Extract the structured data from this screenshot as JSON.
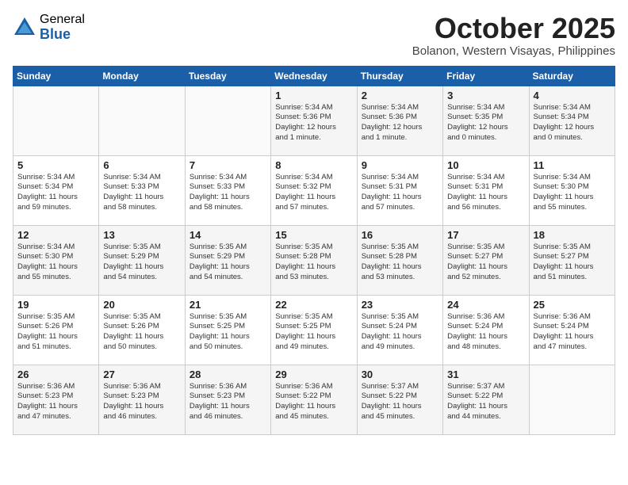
{
  "header": {
    "logo_general": "General",
    "logo_blue": "Blue",
    "month": "October 2025",
    "location": "Bolanon, Western Visayas, Philippines"
  },
  "days_of_week": [
    "Sunday",
    "Monday",
    "Tuesday",
    "Wednesday",
    "Thursday",
    "Friday",
    "Saturday"
  ],
  "weeks": [
    [
      {
        "day": "",
        "info": ""
      },
      {
        "day": "",
        "info": ""
      },
      {
        "day": "",
        "info": ""
      },
      {
        "day": "1",
        "info": "Sunrise: 5:34 AM\nSunset: 5:36 PM\nDaylight: 12 hours\nand 1 minute."
      },
      {
        "day": "2",
        "info": "Sunrise: 5:34 AM\nSunset: 5:36 PM\nDaylight: 12 hours\nand 1 minute."
      },
      {
        "day": "3",
        "info": "Sunrise: 5:34 AM\nSunset: 5:35 PM\nDaylight: 12 hours\nand 0 minutes."
      },
      {
        "day": "4",
        "info": "Sunrise: 5:34 AM\nSunset: 5:34 PM\nDaylight: 12 hours\nand 0 minutes."
      }
    ],
    [
      {
        "day": "5",
        "info": "Sunrise: 5:34 AM\nSunset: 5:34 PM\nDaylight: 11 hours\nand 59 minutes."
      },
      {
        "day": "6",
        "info": "Sunrise: 5:34 AM\nSunset: 5:33 PM\nDaylight: 11 hours\nand 58 minutes."
      },
      {
        "day": "7",
        "info": "Sunrise: 5:34 AM\nSunset: 5:33 PM\nDaylight: 11 hours\nand 58 minutes."
      },
      {
        "day": "8",
        "info": "Sunrise: 5:34 AM\nSunset: 5:32 PM\nDaylight: 11 hours\nand 57 minutes."
      },
      {
        "day": "9",
        "info": "Sunrise: 5:34 AM\nSunset: 5:31 PM\nDaylight: 11 hours\nand 57 minutes."
      },
      {
        "day": "10",
        "info": "Sunrise: 5:34 AM\nSunset: 5:31 PM\nDaylight: 11 hours\nand 56 minutes."
      },
      {
        "day": "11",
        "info": "Sunrise: 5:34 AM\nSunset: 5:30 PM\nDaylight: 11 hours\nand 55 minutes."
      }
    ],
    [
      {
        "day": "12",
        "info": "Sunrise: 5:34 AM\nSunset: 5:30 PM\nDaylight: 11 hours\nand 55 minutes."
      },
      {
        "day": "13",
        "info": "Sunrise: 5:35 AM\nSunset: 5:29 PM\nDaylight: 11 hours\nand 54 minutes."
      },
      {
        "day": "14",
        "info": "Sunrise: 5:35 AM\nSunset: 5:29 PM\nDaylight: 11 hours\nand 54 minutes."
      },
      {
        "day": "15",
        "info": "Sunrise: 5:35 AM\nSunset: 5:28 PM\nDaylight: 11 hours\nand 53 minutes."
      },
      {
        "day": "16",
        "info": "Sunrise: 5:35 AM\nSunset: 5:28 PM\nDaylight: 11 hours\nand 53 minutes."
      },
      {
        "day": "17",
        "info": "Sunrise: 5:35 AM\nSunset: 5:27 PM\nDaylight: 11 hours\nand 52 minutes."
      },
      {
        "day": "18",
        "info": "Sunrise: 5:35 AM\nSunset: 5:27 PM\nDaylight: 11 hours\nand 51 minutes."
      }
    ],
    [
      {
        "day": "19",
        "info": "Sunrise: 5:35 AM\nSunset: 5:26 PM\nDaylight: 11 hours\nand 51 minutes."
      },
      {
        "day": "20",
        "info": "Sunrise: 5:35 AM\nSunset: 5:26 PM\nDaylight: 11 hours\nand 50 minutes."
      },
      {
        "day": "21",
        "info": "Sunrise: 5:35 AM\nSunset: 5:25 PM\nDaylight: 11 hours\nand 50 minutes."
      },
      {
        "day": "22",
        "info": "Sunrise: 5:35 AM\nSunset: 5:25 PM\nDaylight: 11 hours\nand 49 minutes."
      },
      {
        "day": "23",
        "info": "Sunrise: 5:35 AM\nSunset: 5:24 PM\nDaylight: 11 hours\nand 49 minutes."
      },
      {
        "day": "24",
        "info": "Sunrise: 5:36 AM\nSunset: 5:24 PM\nDaylight: 11 hours\nand 48 minutes."
      },
      {
        "day": "25",
        "info": "Sunrise: 5:36 AM\nSunset: 5:24 PM\nDaylight: 11 hours\nand 47 minutes."
      }
    ],
    [
      {
        "day": "26",
        "info": "Sunrise: 5:36 AM\nSunset: 5:23 PM\nDaylight: 11 hours\nand 47 minutes."
      },
      {
        "day": "27",
        "info": "Sunrise: 5:36 AM\nSunset: 5:23 PM\nDaylight: 11 hours\nand 46 minutes."
      },
      {
        "day": "28",
        "info": "Sunrise: 5:36 AM\nSunset: 5:23 PM\nDaylight: 11 hours\nand 46 minutes."
      },
      {
        "day": "29",
        "info": "Sunrise: 5:36 AM\nSunset: 5:22 PM\nDaylight: 11 hours\nand 45 minutes."
      },
      {
        "day": "30",
        "info": "Sunrise: 5:37 AM\nSunset: 5:22 PM\nDaylight: 11 hours\nand 45 minutes."
      },
      {
        "day": "31",
        "info": "Sunrise: 5:37 AM\nSunset: 5:22 PM\nDaylight: 11 hours\nand 44 minutes."
      },
      {
        "day": "",
        "info": ""
      }
    ]
  ]
}
